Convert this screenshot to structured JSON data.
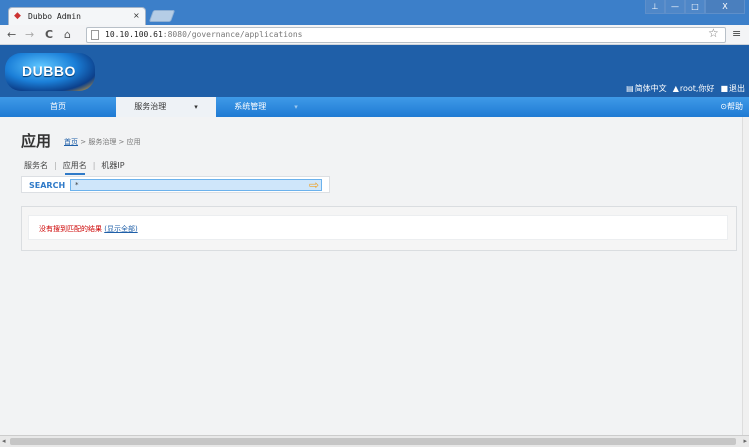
{
  "browser": {
    "tab_title": "Dubbo Admin",
    "tab_close": "×",
    "url_host": "10.10.100.61",
    "url_rest": ":8080/governance/applications",
    "window_controls": [
      "⊥",
      "—",
      "□",
      "X"
    ],
    "back": "←",
    "forward": "→",
    "reload": "C",
    "home": "⌂",
    "star": "☆",
    "menu": "≡"
  },
  "header": {
    "logo_text": "DUBBO",
    "user_links": [
      "简体中文",
      "root,你好",
      "退出"
    ]
  },
  "nav": {
    "items": [
      "首页",
      "服务治理",
      "系统管理"
    ],
    "active_index": 1,
    "dropdown_caret": "▾",
    "help": "帮助"
  },
  "page": {
    "title": "应用",
    "breadcrumb_home": "首页",
    "breadcrumb_rest": " > 服务治理 > 应用",
    "filters": [
      "服务名",
      "应用名",
      "机器IP"
    ],
    "filter_separator": "|",
    "active_filter": 1,
    "search_label": "SEARCH",
    "search_value": "*",
    "search_go_icon": "⇨",
    "result_message": "没有搜到匹配的结果",
    "result_link": "(显示全部)"
  },
  "colors": {
    "header_bg": "#1f5fa8",
    "nav_bg": "#2f88dc",
    "accent": "#2f7ac8",
    "error": "#cc0000"
  }
}
